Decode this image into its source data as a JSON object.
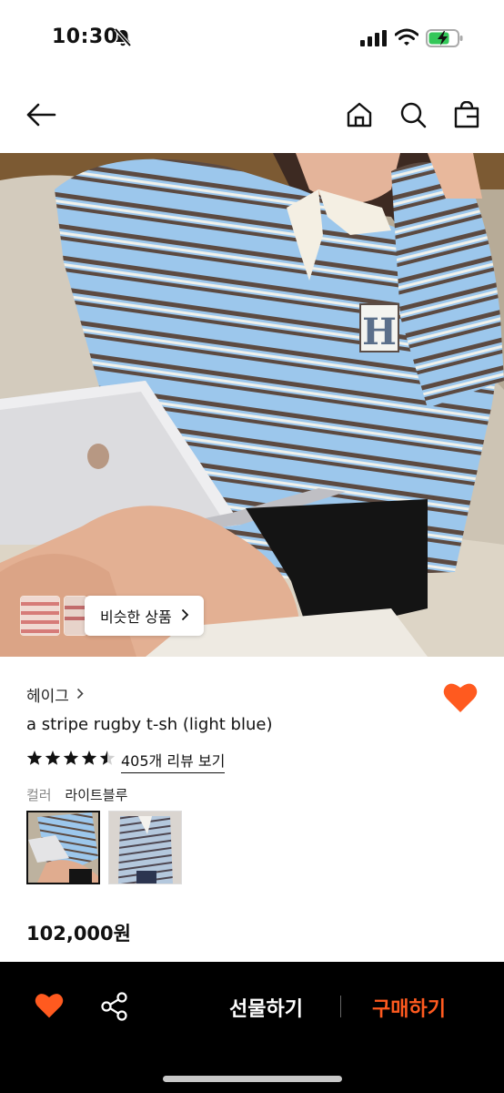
{
  "status_bar": {
    "time": "10:30"
  },
  "product": {
    "brand": "헤이그",
    "name": "a stripe rugby t-sh (light blue)",
    "rating": 4.5,
    "review_link": "405개 리뷰 보기",
    "color_label": "컬러",
    "color_value": "라이트블루",
    "price": "102,000원"
  },
  "similar_button": {
    "label": "비슷한 상품"
  },
  "bottom_bar": {
    "gift_label": "선물하기",
    "buy_label": "구매하기"
  },
  "colors": {
    "accent": "#ff5a1f",
    "stripe_blue": "#8fc0e8",
    "stripe_brown": "#5c4a41"
  },
  "icons": [
    "bell-off-icon",
    "signal-icon",
    "wifi-icon",
    "battery-charging-icon",
    "back-arrow-icon",
    "home-icon",
    "search-icon",
    "shopping-bag-icon",
    "heart-icon",
    "share-icon",
    "star-icon",
    "chevron-right-icon"
  ]
}
